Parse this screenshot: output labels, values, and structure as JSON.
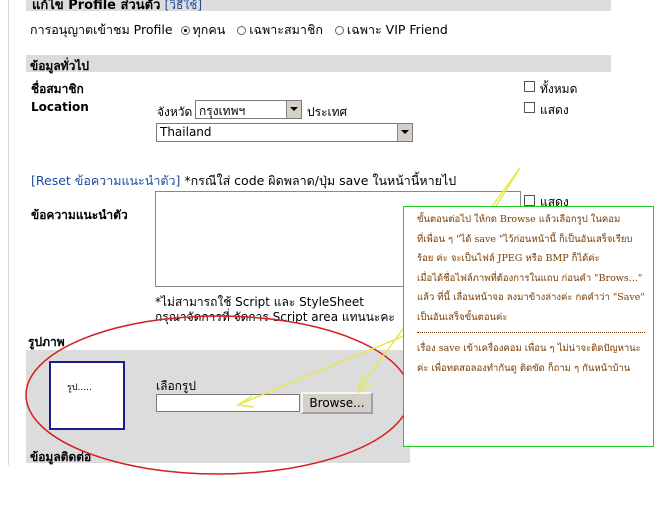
{
  "header": {
    "title": "แก้ไข Profile ส่วนตัว",
    "help_link": "วิธีใช้",
    "permission_label": "การอนุญาตเข้าชม Profile",
    "permission_options": [
      "ทุกคน",
      "เฉพาะสมาชิก",
      "เฉพาะ VIP Friend"
    ],
    "permission_selected": "ทุกคน"
  },
  "general": {
    "section_title": "ข้อมูลทั่วไป",
    "member_name_label": "ชื่อสมาชิก",
    "location_label": "Location",
    "province_label": "จังหวัด",
    "province_value": "กรุงเทพฯ",
    "country_label": "ประเทศ",
    "country_value": "Thailand",
    "show_all_label": "ทั้งหมด",
    "show_label": "แสดง",
    "show_label_2": "แสดง"
  },
  "intro": {
    "reset_link": "[Reset ข้อความแนะนำตัว]",
    "reset_note": "*กรณีใส่ code ผิดพลาด/ปุ่ม save ในหน้านี้หายไป",
    "label": "ข้อความแนะนำตัว",
    "value": "",
    "warning_1": "*ไม่สามารถใช้ Script และ StyleSheet",
    "warning_2": "กรุณาจัดการที่ จัดการ Script area แทนนะคะ"
  },
  "picture": {
    "section_title": "รูปภาพ",
    "placeholder": "รูป.....",
    "choose_label": "เลือกรูป",
    "file_value": "",
    "browse_label": "Browse..."
  },
  "contact": {
    "section_title": "ข้อมูลติดต่อ"
  },
  "annotation": {
    "lines": [
      "ขั้นตอนต่อไป ให้กด Browse แล้วเลือกรูป ในคอม",
      "ที่เพื่อน ๆ \"ได้ save \"ไว้ก่อนหน้านี้  ก็เป็นอันเสร็จเรียบ",
      "ร้อย ค่ะ จะเป็นไฟล์ JPEG หรือ BMP ก็ได้ค่ะ",
      "เมื่อได้ชื่อไฟล์ภาพที่ต้องการในแถบ ก่อนคำ \"Brows...\"",
      "แล้ว ที่นี้ เลื่อนหน้าจอ ลงมาข้างล่างค่ะ กดคำว่า \"Save\"",
      "เป็นอันเสร็จขั้นตอนค่ะ"
    ],
    "footer": "เรื่อง save เข้าเครื่องคอม เพื่อน ๆ ไม่น่าจะติดปัญหานะ ค่ะ  เพื่อทดสอลองทำกันดู ติดขัด ก็ถาม ๆ กันหน้าบ้าน",
    "colors": {
      "box_border": "#22cc22",
      "arrow": "#e8e84a",
      "ellipse": "#d42020",
      "text": "#7a3b00"
    }
  }
}
